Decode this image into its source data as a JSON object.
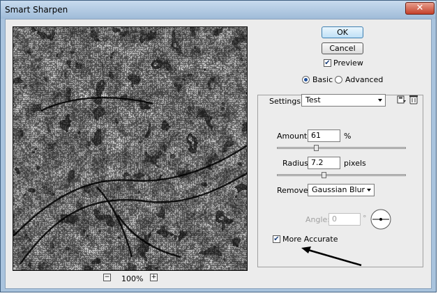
{
  "window": {
    "title": "Smart Sharpen",
    "close_label": "✕"
  },
  "buttons": {
    "ok": "OK",
    "cancel": "Cancel"
  },
  "preview_option": {
    "label": "Preview",
    "checked": true
  },
  "mode": {
    "basic": "Basic",
    "advanced": "Advanced",
    "selected": "Basic"
  },
  "settings": {
    "label": "Settings:",
    "value": "Test"
  },
  "amount": {
    "label": "Amount:",
    "value": "61",
    "unit": "%",
    "level": 0.305
  },
  "radius": {
    "label": "Radius:",
    "value": "7.2",
    "unit": "pixels",
    "level": 0.36
  },
  "remove": {
    "label": "Remove:",
    "value": "Gaussian Blur"
  },
  "angle": {
    "label": "Angle:",
    "value": "0",
    "unit": "°"
  },
  "more_accurate": {
    "label": "More Accurate",
    "checked": true
  },
  "zoom": {
    "minus": "−",
    "plus": "+",
    "level": "100%"
  },
  "icons": [
    "save-settings-icon",
    "delete-settings-icon",
    "angle-dial-icon",
    "annotation-arrow-icon"
  ]
}
